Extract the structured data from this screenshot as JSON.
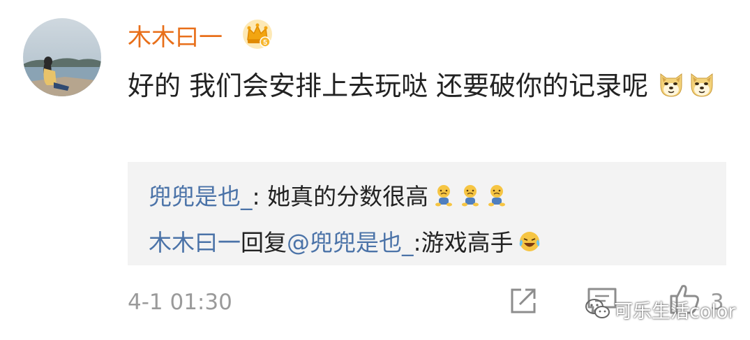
{
  "comment": {
    "username": "木木曰一",
    "text": "好的 我们会安排上去玩哒 还要破你的记录呢",
    "emojis": [
      "doge-emoji",
      "doge-emoji"
    ]
  },
  "replies": [
    {
      "author": "兜兜是也_",
      "separator": ": ",
      "text": "她真的分数很高",
      "emojis": [
        "sad-emoji",
        "sad-emoji",
        "sad-emoji"
      ]
    },
    {
      "author": "木木曰一",
      "reply_word": "回复",
      "mention": "@兜兜是也_",
      "separator": ":",
      "text": "游戏高手",
      "emojis": [
        "laugh-cry-emoji"
      ]
    }
  ],
  "meta": {
    "timestamp": "4-1 01:30",
    "like_count": "3"
  },
  "watermark": {
    "text": "可乐生活color"
  },
  "colors": {
    "username": "#e86f1a",
    "link": "#4b73a8",
    "reply_bg": "#f3f3f3",
    "meta_gray": "#9a9a9a"
  },
  "icons": [
    "vip-crown-icon",
    "share-icon",
    "comment-icon",
    "like-icon",
    "wechat-icon"
  ]
}
